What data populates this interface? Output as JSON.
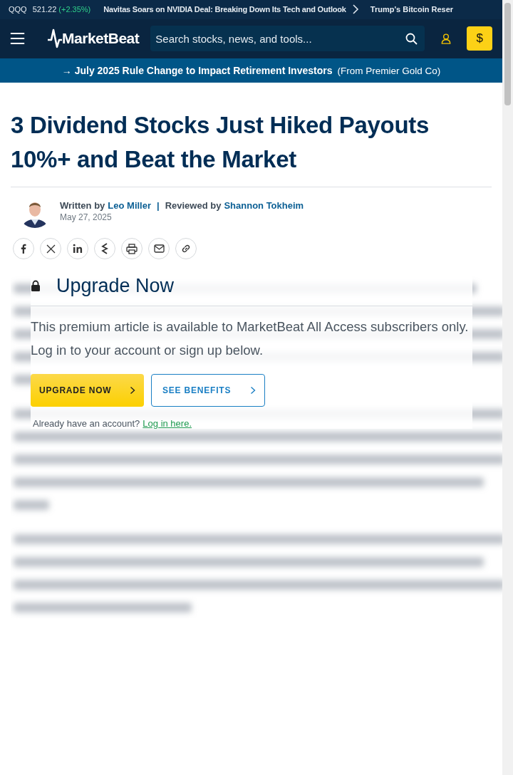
{
  "ticker": {
    "symbol": "QQQ",
    "price": "521.22",
    "change": "(+2.35%)",
    "headline": "Navitas Soars on NVIDIA Deal: Breaking Down Its Tech and Outlook",
    "next_headline": "Trump's Bitcoin Reser"
  },
  "header": {
    "logo": "MarketBeat",
    "search": {
      "placeholder": "Search stocks, news, and tools..."
    },
    "buy_button": "$"
  },
  "banner": {
    "headline": "→ July 2025 Rule Change to Impact Retirement Investors",
    "source": "(From Premier Gold Co)"
  },
  "article": {
    "title": "3 Dividend Stocks Just Hiked Payouts 10%+ and Beat the Market",
    "written_by": "Written by",
    "author": "Leo Miller",
    "separator": "|",
    "reviewed_by": "Reviewed by",
    "reviewer": "Shannon Tokheim",
    "date": "May 27, 2025",
    "share_buttons": [
      {
        "kind": "facebook"
      },
      {
        "kind": "x"
      },
      {
        "kind": "linkedin"
      },
      {
        "kind": "stocktwits"
      },
      {
        "kind": "print"
      },
      {
        "kind": "email"
      },
      {
        "kind": "link"
      }
    ]
  },
  "paywall": {
    "title": "Upgrade Now",
    "message": "This premium article is available to MarketBeat All Access subscribers only. Log in to your account or sign up below.",
    "primary_button": "UPGRADE NOW",
    "secondary_button": "SEE BENEFITS",
    "login_prompt": "Already have an account?",
    "login_link": "Log in here."
  }
}
